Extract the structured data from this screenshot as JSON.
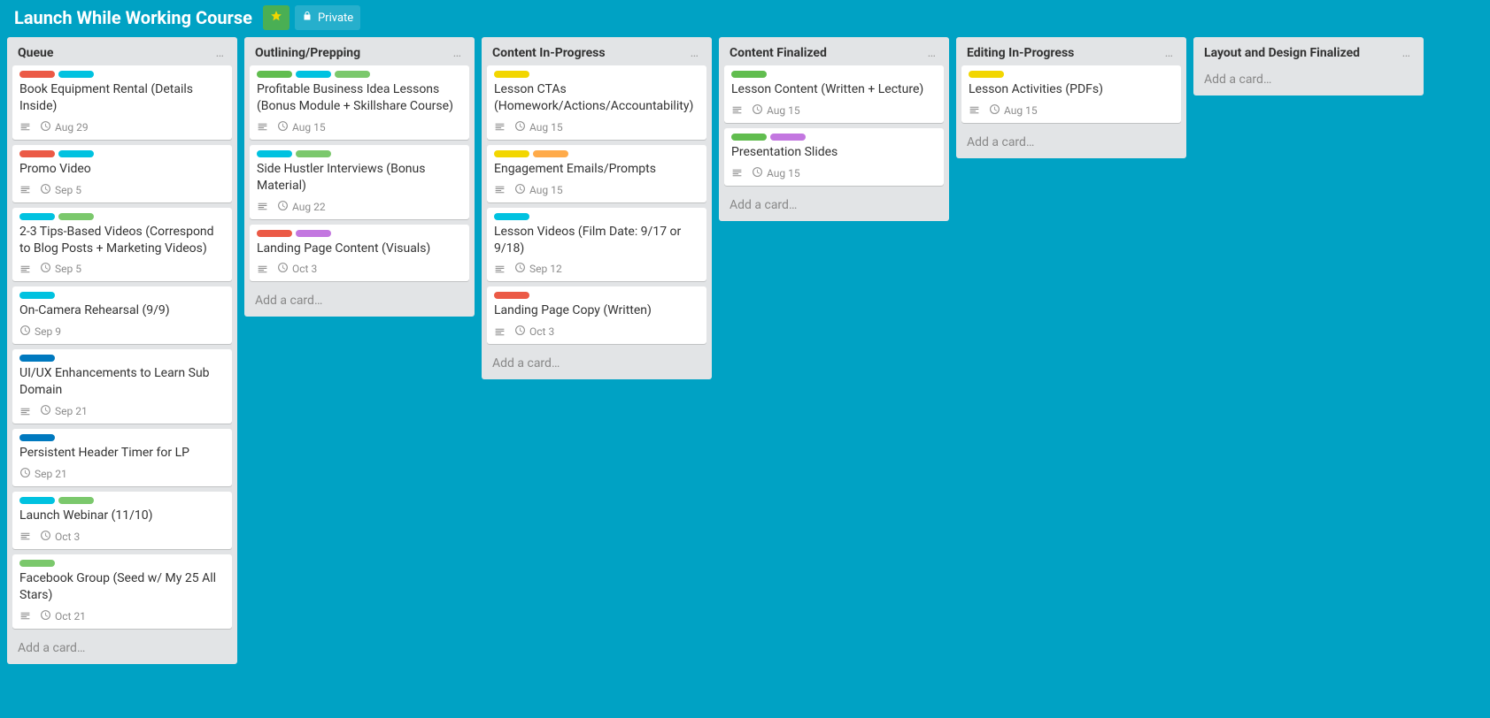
{
  "header": {
    "title": "Launch While Working Course",
    "privacy_label": "Private"
  },
  "add_card_label": "Add a card…",
  "label_colors": {
    "green": "#61bd4f",
    "yellow": "#f2d600",
    "orange": "#ffab4a",
    "red": "#eb5a46",
    "purple": "#c377e0",
    "blue": "#0079bf",
    "sky": "#00c2e0",
    "lightgreen": "#7bc86c"
  },
  "lists": [
    {
      "title": "Queue",
      "cards": [
        {
          "labels": [
            "red",
            "sky"
          ],
          "title": "Book Equipment Rental (Details Inside)",
          "has_desc": true,
          "due": "Aug 29"
        },
        {
          "labels": [
            "red",
            "sky"
          ],
          "title": "Promo Video",
          "has_desc": true,
          "due": "Sep 5"
        },
        {
          "labels": [
            "sky",
            "lightgreen"
          ],
          "title": "2-3 Tips-Based Videos (Correspond to Blog Posts + Marketing Videos)",
          "has_desc": true,
          "due": "Sep 5"
        },
        {
          "labels": [
            "sky"
          ],
          "title": "On-Camera Rehearsal (9/9)",
          "has_desc": false,
          "due": "Sep 9"
        },
        {
          "labels": [
            "blue"
          ],
          "title": "UI/UX Enhancements to Learn Sub Domain",
          "has_desc": true,
          "due": "Sep 21"
        },
        {
          "labels": [
            "blue"
          ],
          "title": "Persistent Header Timer for LP",
          "has_desc": false,
          "due": "Sep 21"
        },
        {
          "labels": [
            "sky",
            "lightgreen"
          ],
          "title": "Launch Webinar (11/10)",
          "has_desc": true,
          "due": "Oct 3"
        },
        {
          "labels": [
            "lightgreen"
          ],
          "title": "Facebook Group (Seed w/ My 25 All Stars)",
          "has_desc": true,
          "due": "Oct 21"
        }
      ]
    },
    {
      "title": "Outlining/Prepping",
      "cards": [
        {
          "labels": [
            "green",
            "sky",
            "lightgreen"
          ],
          "title": "Profitable Business Idea Lessons (Bonus Module + Skillshare Course)",
          "has_desc": true,
          "due": "Aug 15"
        },
        {
          "labels": [
            "sky",
            "lightgreen"
          ],
          "title": "Side Hustler Interviews (Bonus Material)",
          "has_desc": true,
          "due": "Aug 22"
        },
        {
          "labels": [
            "red",
            "purple"
          ],
          "title": "Landing Page Content (Visuals)",
          "has_desc": true,
          "due": "Oct 3"
        }
      ]
    },
    {
      "title": "Content In-Progress",
      "cards": [
        {
          "labels": [
            "yellow"
          ],
          "title": "Lesson CTAs (Homework/Actions/Accountability)",
          "has_desc": true,
          "due": "Aug 15"
        },
        {
          "labels": [
            "yellow",
            "orange"
          ],
          "title": "Engagement Emails/Prompts",
          "has_desc": true,
          "due": "Aug 15"
        },
        {
          "labels": [
            "sky"
          ],
          "title": "Lesson Videos (Film Date: 9/17 or 9/18)",
          "has_desc": true,
          "due": "Sep 12"
        },
        {
          "labels": [
            "red"
          ],
          "title": "Landing Page Copy (Written)",
          "has_desc": true,
          "due": "Oct 3"
        }
      ]
    },
    {
      "title": "Content Finalized",
      "cards": [
        {
          "labels": [
            "green"
          ],
          "title": "Lesson Content (Written + Lecture)",
          "has_desc": true,
          "due": "Aug 15"
        },
        {
          "labels": [
            "green",
            "purple"
          ],
          "title": "Presentation Slides",
          "has_desc": true,
          "due": "Aug 15"
        }
      ]
    },
    {
      "title": "Editing In-Progress",
      "cards": [
        {
          "labels": [
            "yellow"
          ],
          "title": "Lesson Activities (PDFs)",
          "has_desc": true,
          "due": "Aug 15"
        }
      ]
    },
    {
      "title": "Layout and Design Finalized",
      "cards": []
    }
  ]
}
